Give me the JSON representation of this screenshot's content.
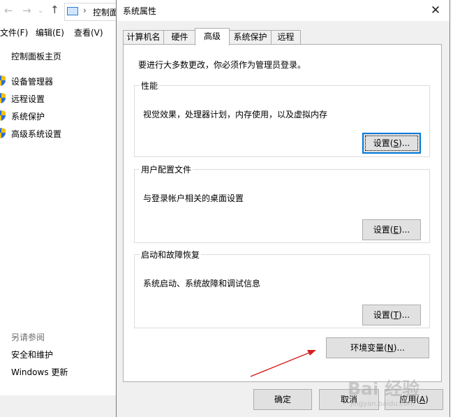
{
  "background_window": {
    "address_text": "控制面",
    "menu": [
      "文件(F)",
      "编辑(E)",
      "查看(V)"
    ],
    "home_link": "控制面板主页",
    "tasks": [
      {
        "label": "设备管理器",
        "icon": "shield-icon"
      },
      {
        "label": "远程设置",
        "icon": "shield-icon"
      },
      {
        "label": "系统保护",
        "icon": "shield-icon"
      },
      {
        "label": "高级系统设置",
        "icon": "shield-icon"
      }
    ],
    "see_also_title": "另请参阅",
    "see_also_links": [
      "安全和维护",
      "Windows 更新"
    ]
  },
  "dialog": {
    "title": "系统属性",
    "close_glyph": "✕",
    "tabs": [
      {
        "label": "计算机名",
        "active": false
      },
      {
        "label": "硬件",
        "active": false
      },
      {
        "label": "高级",
        "active": true
      },
      {
        "label": "系统保护",
        "active": false
      },
      {
        "label": "远程",
        "active": false
      }
    ],
    "admin_note": "要进行大多数更改，你必须作为管理员登录。",
    "groups": {
      "performance": {
        "title": "性能",
        "description": "视觉效果，处理器计划，内存使用，以及虚拟内存",
        "button_text": "设置",
        "button_key": "S"
      },
      "user_profiles": {
        "title": "用户配置文件",
        "description": "与登录帐户相关的桌面设置",
        "button_text": "设置",
        "button_key": "E"
      },
      "startup_recovery": {
        "title": "启动和故障恢复",
        "description": "系统启动、系统故障和调试信息",
        "button_text": "设置",
        "button_key": "T"
      }
    },
    "env_button_text": "环境变量",
    "env_button_key": "N",
    "ok_label": "确定",
    "cancel_label": "取消",
    "apply_text": "应用",
    "apply_key": "A"
  },
  "annotation": {
    "color": "#d62020"
  },
  "watermark": {
    "brand": "Bai 经验",
    "url": "jingyan.baidu.com"
  },
  "colors": {
    "accent": "#0078d7",
    "dialog_bg": "#f0f0f0",
    "button_bg": "#e1e1e1"
  }
}
